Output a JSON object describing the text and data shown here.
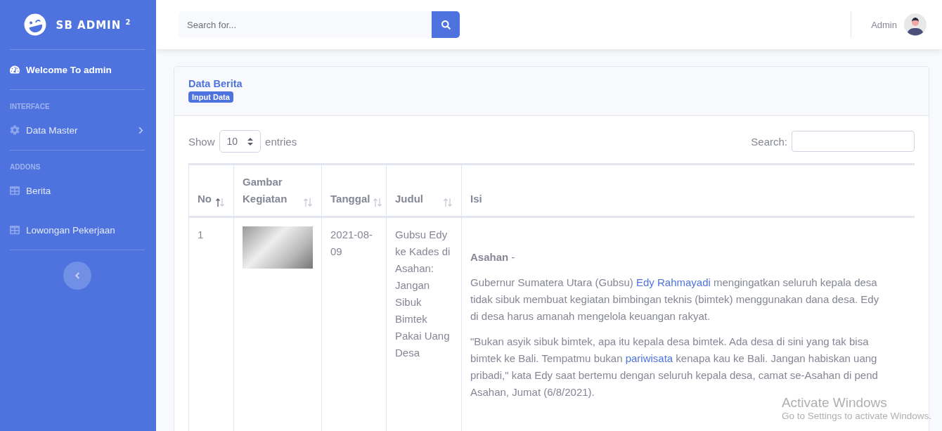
{
  "sidebar": {
    "brand": "SB ADMIN $^{2}$",
    "items": [
      {
        "kind": "link",
        "label": "Welcome To admin",
        "selected": true
      },
      {
        "kind": "heading",
        "label": "INTERFACE"
      },
      {
        "kind": "link",
        "label": "Data Master",
        "selected": false,
        "expanded": false
      },
      {
        "kind": "heading",
        "label": "ADDONS"
      },
      {
        "kind": "link",
        "label": "Berita",
        "selected": false
      },
      {
        "kind": "link",
        "label": "Lowongan Pekerjaan",
        "selected": false
      }
    ]
  },
  "topbar": {
    "search": {
      "placeholder": "Search for..."
    },
    "user": {
      "name": "Admin"
    }
  },
  "card": {
    "title": "Data Berita",
    "badge": "Input Data",
    "length": {
      "label": "Show",
      "value": "10",
      "suffix": "entries"
    },
    "search": {
      "label": "Search:"
    },
    "columns": [
      {
        "label": "No",
        "sortable": true,
        "sorted": true
      },
      {
        "label": "Gambar Kegiatan",
        "sortable": true,
        "sorted": false
      },
      {
        "label": "Tanggal",
        "sortable": true,
        "sorted": false
      },
      {
        "label": "Judul",
        "sortable": true,
        "sorted": false
      },
      {
        "label": "Isi"
      }
    ],
    "rows": [
      {
        "no": "1",
        "tanggal": "2021-08-09",
        "judul": "Gubsu Edy ke Kades di Asahan: Jangan Sibuk Bimtek Pakai Uang Desa",
        "isi": [
          [
            [
              {
                "kind": "text",
                "text": "**Asahan** -"
              }
            ]
          ],
          [
            [
              {
                "kind": "text",
                "text": "Gubernur Sumatera Utara (Gubsu) "
              },
              {
                "kind": "link",
                "text": "Edy Rahmayadi"
              },
              {
                "kind": "text",
                "text": " mengingatkan seluruh kepala desa"
              }
            ],
            [
              {
                "kind": "text",
                "text": "tidak sibuk membuat kegiatan bimbingan teknis (bimtek) menggunakan dana desa. Edy"
              }
            ],
            [
              {
                "kind": "text",
                "text": "di desa harus amanah mengelola keuangan rakyat."
              }
            ]
          ],
          [
            [
              {
                "kind": "text",
                "text": "\"Bukan asyik sibuk bimtek, apa itu kepala desa bimtek. Ada desa di sini yang tak bisa"
              }
            ],
            [
              {
                "kind": "text",
                "text": "bimtek ke Bali. Tempatmu bukan "
              },
              {
                "kind": "link",
                "text": "pariwisata"
              },
              {
                "kind": "text",
                "text": " kenapa kau ke Bali. Jangan habiskan uang"
              }
            ],
            [
              {
                "kind": "text",
                "text": "pribadi,\" kata Edy saat bertemu dengan seluruh kepala desa, camat se-Asahan di pend"
              }
            ],
            [
              {
                "kind": "text",
                "text": "Asahan, Jumat (6/8/2021)."
              }
            ]
          ]
        ]
      }
    ]
  },
  "os_notice": {
    "title": "Activate Windows",
    "text": "Go to Settings to activate Windows."
  }
}
